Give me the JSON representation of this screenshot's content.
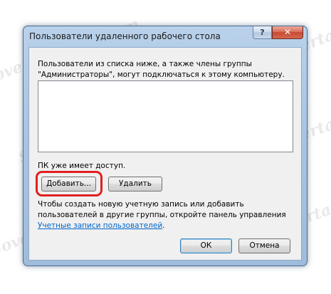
{
  "window": {
    "title": "Пользователи удаленного рабочего стола",
    "help_label": "?",
    "close_label": "✕"
  },
  "description": "Пользователи из списка ниже, а также члены группы \"Администраторы\", могут подключаться к этому компьютеру.",
  "user_list": [],
  "access_text": "ПК уже имеет доступ.",
  "buttons": {
    "add_label": "Добавить...",
    "remove_label": "Удалить",
    "ok_label": "ОК",
    "cancel_label": "Отмена"
  },
  "hint": {
    "text": "Чтобы создать новую учетную запись или добавить пользователей в другие группы, откройте панель управления ",
    "link": "Учетные записи пользователей",
    "suffix": "."
  },
  "watermark": "Sovetyexperta.com",
  "colors": {
    "highlight": "#e02020",
    "link": "#0066cc",
    "title_bar": "#b9d1ea",
    "close_button": "#c64a33"
  }
}
